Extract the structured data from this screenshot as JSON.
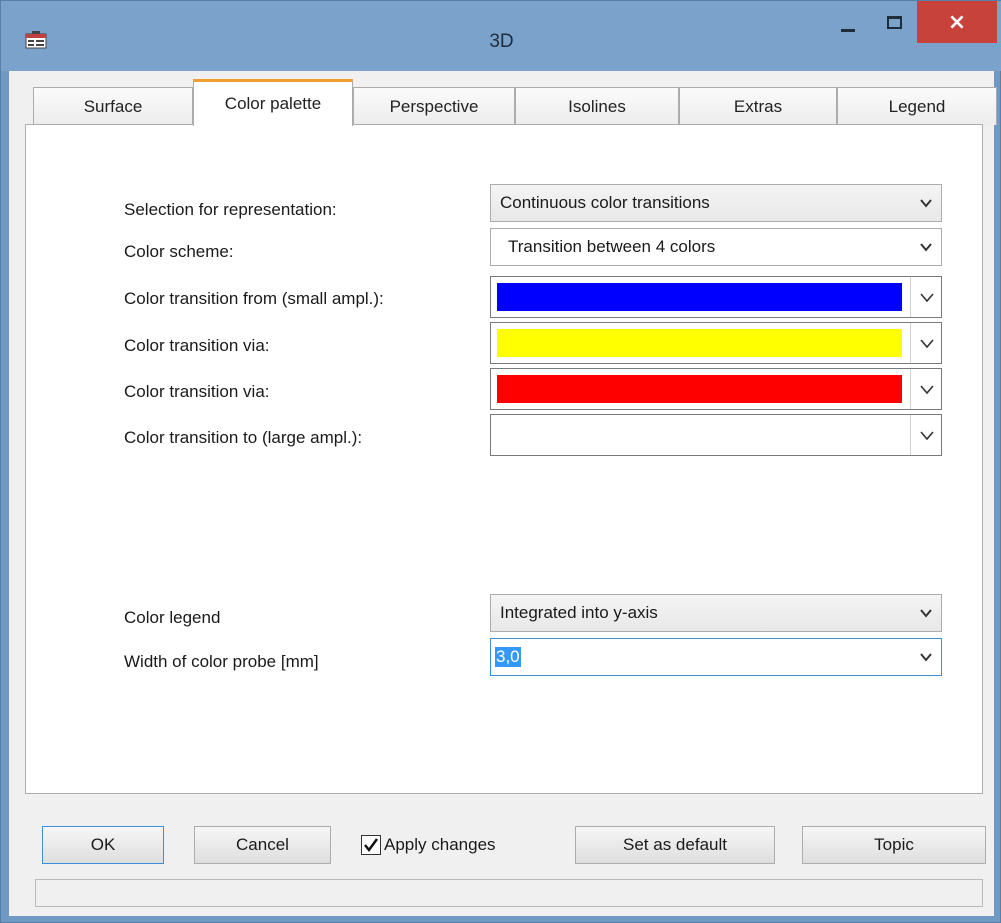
{
  "window": {
    "title": "3D"
  },
  "titlebar": {
    "close_glyph": "×"
  },
  "tabs": [
    {
      "label": "Surface"
    },
    {
      "label": "Color palette"
    },
    {
      "label": "Perspective"
    },
    {
      "label": "Isolines"
    },
    {
      "label": "Extras"
    },
    {
      "label": "Legend"
    }
  ],
  "active_tab": "Color palette",
  "form": {
    "representation": {
      "label": "Selection for representation:",
      "value": "Continuous color transitions"
    },
    "scheme": {
      "label": "Color scheme:",
      "value": "Transition between 4 colors"
    },
    "from": {
      "label": "Color transition from (small ampl.):",
      "color": "#0000ff"
    },
    "via1": {
      "label": "Color transition via:",
      "color": "#ffff00"
    },
    "via2": {
      "label": "Color transition via:",
      "color": "#ff0000"
    },
    "to": {
      "label": "Color transition to (large ampl.):",
      "color": "#ffffff"
    },
    "legend": {
      "label": "Color legend",
      "value": "Integrated into y-axis"
    },
    "probe_width": {
      "label": "Width of color probe [mm]",
      "value": "3,0"
    }
  },
  "buttons": {
    "ok": "OK",
    "cancel": "Cancel",
    "apply_label": "Apply changes",
    "apply_checked": true,
    "set_default": "Set as default",
    "topic": "Topic"
  },
  "status_bar": {
    "text": ""
  }
}
